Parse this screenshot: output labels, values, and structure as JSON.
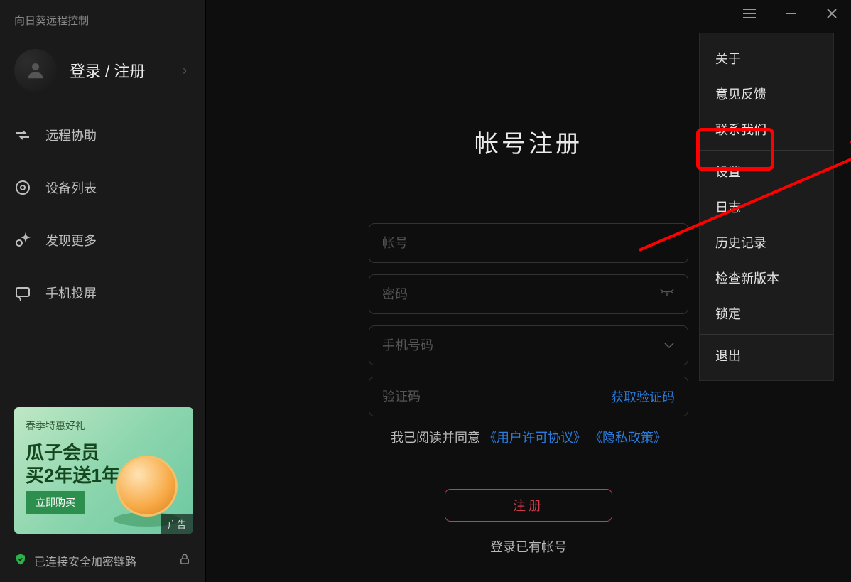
{
  "app_title": "向日葵远程控制",
  "sidebar": {
    "login_label": "登录 / 注册",
    "items": [
      {
        "label": "远程协助"
      },
      {
        "label": "设备列表"
      },
      {
        "label": "发现更多"
      },
      {
        "label": "手机投屏"
      }
    ]
  },
  "promo": {
    "tag": "春季特惠好礼",
    "line1": "瓜子会员",
    "line2": "买2年送1年",
    "cta": "立即购买",
    "badge": "广告"
  },
  "status": {
    "text": "已连接安全加密链路"
  },
  "menu": {
    "items": [
      "关于",
      "意见反馈",
      "联系我们",
      "设置",
      "日志",
      "历史记录",
      "检查新版本",
      "锁定",
      "退出"
    ]
  },
  "form": {
    "title": "帐号注册",
    "account_placeholder": "帐号",
    "password_placeholder": "密码",
    "phone_placeholder": "手机号码",
    "code_placeholder": "验证码",
    "get_code": "获取验证码",
    "agree_prefix": "我已阅读并同意",
    "license": "《用户许可协议》",
    "privacy": "《隐私政策》",
    "submit": "注册",
    "login_existing": "登录已有帐号"
  }
}
